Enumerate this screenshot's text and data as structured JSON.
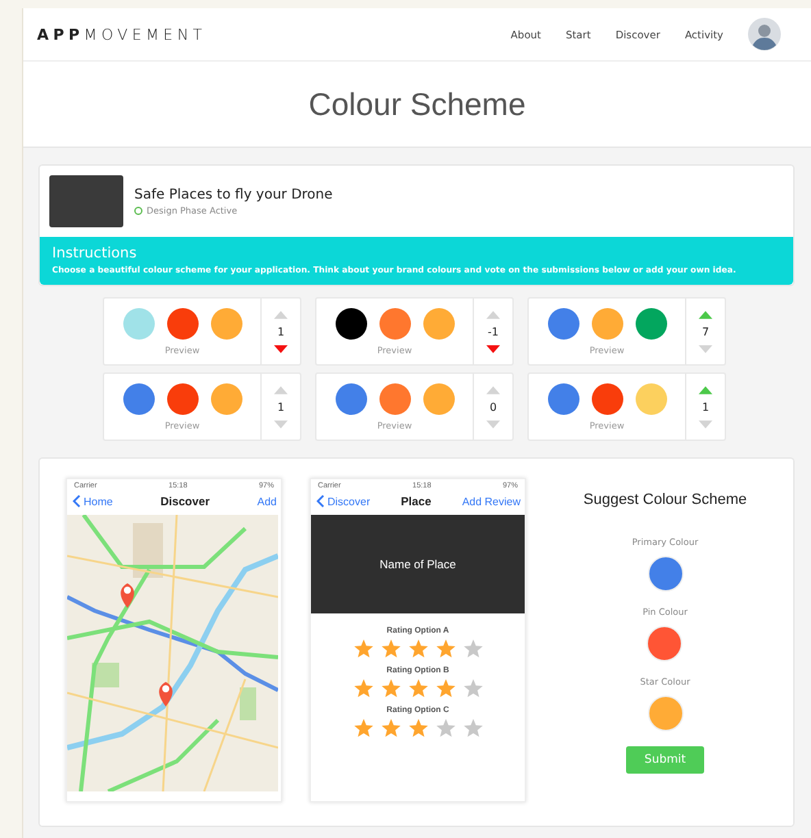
{
  "header": {
    "logo_bold": "APP",
    "logo_light": "MOVEMENT",
    "nav": [
      {
        "label": "About"
      },
      {
        "label": "Start"
      },
      {
        "label": "Discover"
      },
      {
        "label": "Activity"
      }
    ]
  },
  "page_title": "Colour Scheme",
  "app": {
    "name": "Safe Places to fly your Drone",
    "status": "Design Phase Active"
  },
  "instructions": {
    "title": "Instructions",
    "text": "Choose a beautiful colour scheme for your application. Think about your brand colours and vote on the submissions below or add your own idea."
  },
  "schemes": [
    {
      "swatches": [
        {
          "color": "#a0e2e8"
        },
        {
          "color": "#f93d0b"
        },
        {
          "color": "#ffab36"
        }
      ],
      "preview": "Preview",
      "score": "1",
      "upvoted": false,
      "downvoted": true
    },
    {
      "swatches": [
        {
          "color": "#000000"
        },
        {
          "color": "#ff772e"
        },
        {
          "color": "#ffab36"
        }
      ],
      "preview": "Preview",
      "score": "-1",
      "upvoted": false,
      "downvoted": true
    },
    {
      "swatches": [
        {
          "color": "#4380e8"
        },
        {
          "color": "#ffab36"
        },
        {
          "color": "#03a65e"
        }
      ],
      "preview": "Preview",
      "score": "7",
      "upvoted": true,
      "downvoted": false
    },
    {
      "swatches": [
        {
          "color": "#4380e8"
        },
        {
          "color": "#f93d0b"
        },
        {
          "color": "#ffab36"
        }
      ],
      "preview": "Preview",
      "score": "1",
      "upvoted": false,
      "downvoted": false
    },
    {
      "swatches": [
        {
          "color": "#4380e8"
        },
        {
          "color": "#ff772e"
        },
        {
          "color": "#ffab36"
        }
      ],
      "preview": "Preview",
      "score": "0",
      "upvoted": false,
      "downvoted": false
    },
    {
      "swatches": [
        {
          "color": "#4380e8"
        },
        {
          "color": "#f93d0b"
        },
        {
          "color": "#fcd05e"
        }
      ],
      "preview": "Preview",
      "score": "1",
      "upvoted": true,
      "downvoted": false
    }
  ],
  "phones": [
    {
      "kind": "map",
      "carrier": "Carrier",
      "time": "15:18",
      "battery": "97%",
      "back": "Home",
      "title": "Discover",
      "action": "Add"
    },
    {
      "kind": "place",
      "carrier": "Carrier",
      "time": "15:18",
      "battery": "97%",
      "back": "Discover",
      "title": "Place",
      "action": "Add Review",
      "place_name": "Name of Place",
      "ratings": [
        {
          "label": "Rating Option A",
          "stars": 4
        },
        {
          "label": "Rating Option B",
          "stars": 4
        },
        {
          "label": "Rating Option C",
          "stars": 3
        }
      ]
    }
  ],
  "suggest": {
    "title": "Suggest Colour Scheme",
    "fields": [
      {
        "label": "Primary Colour",
        "color": "#4380e8"
      },
      {
        "label": "Pin Colour",
        "color": "#ff5535"
      },
      {
        "label": "Star Colour",
        "color": "#ffab36"
      }
    ],
    "submit": "Submit"
  }
}
